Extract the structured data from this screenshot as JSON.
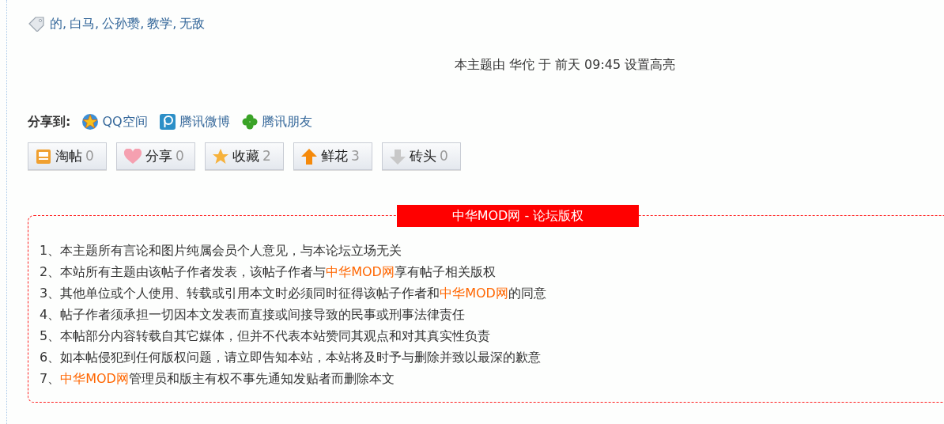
{
  "tags": [
    {
      "label": "的",
      "separator": ","
    },
    {
      "label": "白马",
      "separator": ","
    },
    {
      "label": "公孙瓒",
      "separator": ","
    },
    {
      "label": "教学",
      "separator": ","
    },
    {
      "label": "无敌"
    }
  ],
  "highlight_notice": "本主题由 华佗 于 前天 09:45 设置高亮",
  "share": {
    "label": "分享到:",
    "targets": [
      {
        "label": "QQ空间",
        "kind": "qzone"
      },
      {
        "label": "腾讯微博",
        "kind": "weibo"
      },
      {
        "label": "腾讯朋友",
        "kind": "friends"
      }
    ]
  },
  "actions": [
    {
      "label": "淘帖",
      "count": "0",
      "kind": "collect"
    },
    {
      "label": "分享",
      "count": "0",
      "kind": "share"
    },
    {
      "label": "收藏",
      "count": "2",
      "kind": "favorite"
    },
    {
      "label": "鲜花",
      "count": "3",
      "kind": "flower"
    },
    {
      "label": "砖头",
      "count": "0",
      "kind": "brick"
    }
  ],
  "copyright": {
    "title": "中华MOD网 - 论坛版权",
    "lines": [
      [
        {
          "text": "1、本主题所有言论和图片纯属会员个人意见，与本论坛立场无关",
          "kind": "plain"
        }
      ],
      [
        {
          "text": "2、本站所有主题由该帖子作者发表，该帖子作者与",
          "kind": "plain"
        },
        {
          "text": "中华MOD网",
          "kind": "brand"
        },
        {
          "text": "享有帖子相关版权",
          "kind": "plain"
        }
      ],
      [
        {
          "text": "3、其他单位或个人使用、转载或引用本文时必须同时征得该帖子作者和",
          "kind": "plain"
        },
        {
          "text": "中华MOD网",
          "kind": "brand"
        },
        {
          "text": "的同意",
          "kind": "plain"
        }
      ],
      [
        {
          "text": "4、帖子作者须承担一切因本文发表而直接或间接导致的民事或刑事法律责任",
          "kind": "plain"
        }
      ],
      [
        {
          "text": "5、本帖部分内容转载自其它媒体，但并不代表本站赞同其观点和对其真实性负责",
          "kind": "plain"
        }
      ],
      [
        {
          "text": "6、如本帖侵犯到任何版权问题，请立即告知本站，本站将及时予与删除并致以最深的歉意",
          "kind": "plain"
        }
      ],
      [
        {
          "text": "7、",
          "kind": "plain"
        },
        {
          "text": "中华MOD网",
          "kind": "brand"
        },
        {
          "text": "管理员和版主有权不事先通知发贴者而删除本文",
          "kind": "plain"
        }
      ]
    ]
  }
}
